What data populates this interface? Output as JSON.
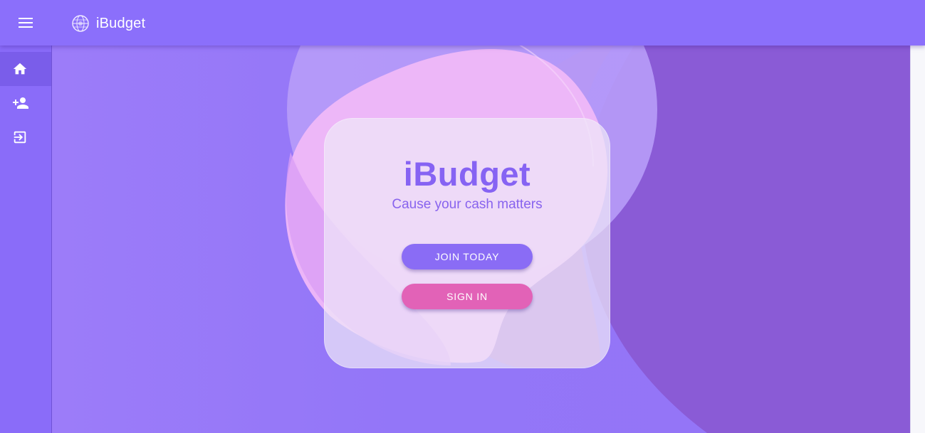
{
  "app_bar": {
    "title": "iBudget",
    "menu_icon": "menu-icon",
    "logo_icon": "globe-logo-icon",
    "background": "#8b6ffb"
  },
  "sidebar": {
    "items": [
      {
        "icon": "home-icon",
        "active": true
      },
      {
        "icon": "person-add-icon",
        "active": false
      },
      {
        "icon": "login-icon",
        "active": false
      }
    ]
  },
  "hero": {
    "title": "iBudget",
    "subtitle": "Cause your cash matters",
    "join_label": "JOIN TODAY",
    "signin_label": "SIGN IN"
  },
  "colors": {
    "primary": "#8a6cf5",
    "accent": "#e262b7",
    "title": "#8663f3"
  }
}
